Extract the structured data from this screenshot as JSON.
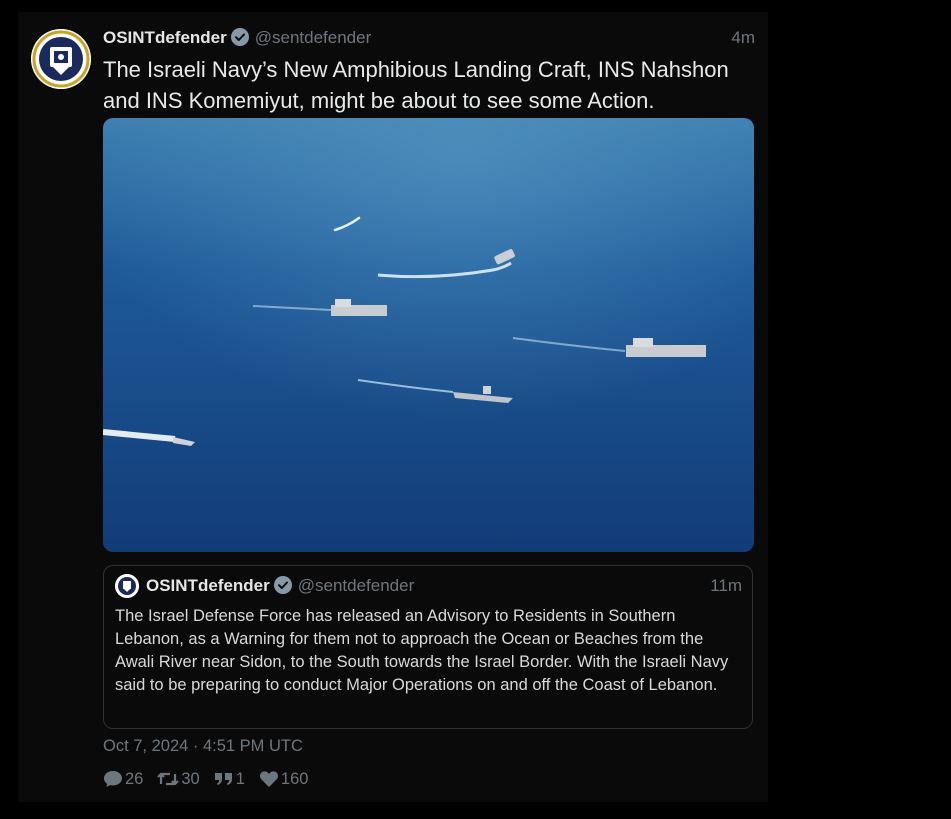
{
  "tweet": {
    "author_name": "OSINTdefender",
    "handle": "@sentdefender",
    "time": "4m",
    "text": "The Israeli Navy’s New Amphibious Landing Craft, INS Nahshon and INS Komemiyut, might be about to see some Action.",
    "date": "Oct 7, 2024 · 4:51 PM UTC",
    "media_description": "Aerial photo of several navy ships sailing on deep blue sea"
  },
  "quote": {
    "author_name": "OSINTdefender",
    "handle": "@sentdefender",
    "time": "11m",
    "text": "The Israel Defense Force has released an Advisory to Residents in Southern Lebanon, as a Warning for them not to approach the Ocean or Beaches from the Awali River near Sidon, to the South towards the Israel Border. With the Israeli Navy said to be preparing to conduct Major Operations on and off the Coast of Lebanon."
  },
  "stats": {
    "replies": "26",
    "retweets": "30",
    "quotes": "1",
    "likes": "160"
  },
  "colors": {
    "background": "#000000",
    "muted": "#6e767d",
    "verified_badge": "#8899a6",
    "sea": "#1d4f86"
  }
}
